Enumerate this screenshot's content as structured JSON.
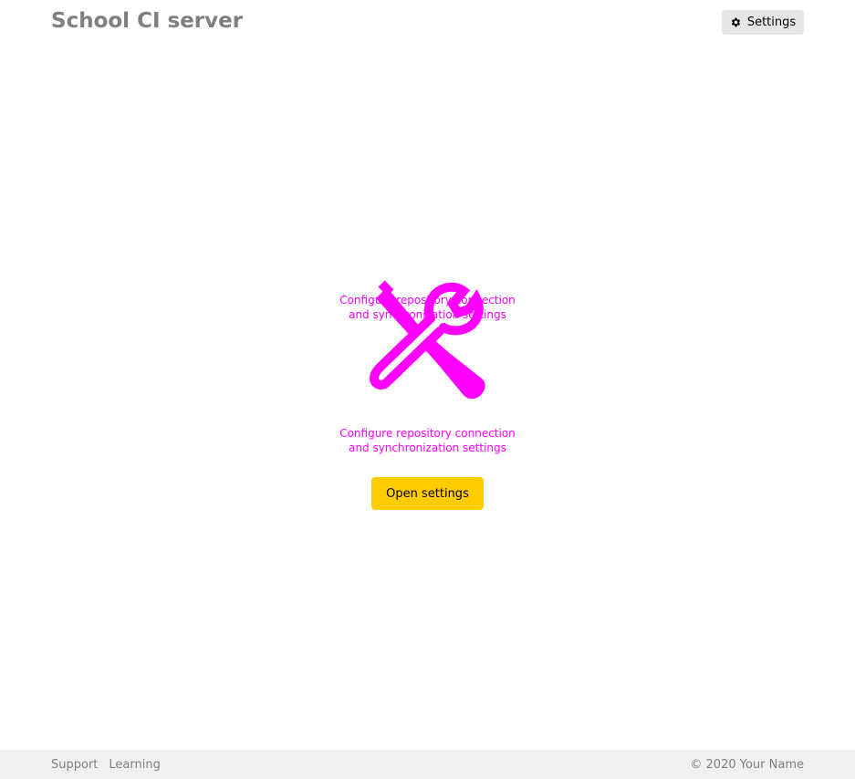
{
  "header": {
    "title": "School CI server",
    "settings_label": "Settings"
  },
  "main": {
    "icon_overlay_text": "Configure repository connection\nand synchronization settings",
    "message": "Configure repository connection\nand synchronization settings",
    "open_settings_label": "Open settings",
    "accent_color": "#ff00ff"
  },
  "footer": {
    "links": [
      "Support",
      "Learning"
    ],
    "copyright": "© 2020 Your Name"
  },
  "colors": {
    "button_yellow": "#ffcc00",
    "footer_bg": "#f0f0f2",
    "muted_text": "#7f7f7f"
  },
  "icons": {
    "settings": "gear-icon",
    "tools": "wrench-screwdriver-icon"
  }
}
